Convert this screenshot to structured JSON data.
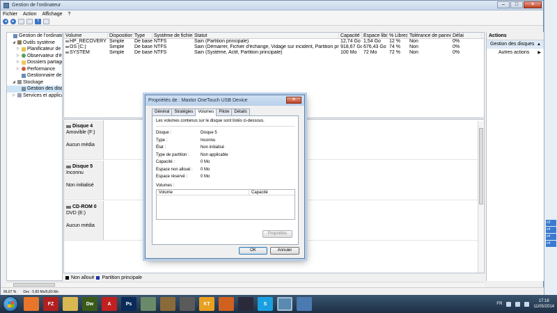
{
  "window": {
    "title": "Gestion de l'ordinateur",
    "controls": [
      "–",
      "□",
      "✕"
    ]
  },
  "menu": [
    "Fichier",
    "Action",
    "Affichage",
    "?"
  ],
  "tree": [
    {
      "label": "Gestion de l'ordinateur (l",
      "indent": 0,
      "arrow": "",
      "icon": "pc"
    },
    {
      "label": "Outils système",
      "indent": 1,
      "arrow": "◢",
      "icon": "tools"
    },
    {
      "label": "Planificateur de t",
      "indent": 2,
      "arrow": "▷",
      "icon": "yellow"
    },
    {
      "label": "Observateur d'évén",
      "indent": 2,
      "arrow": "▷",
      "icon": "eye"
    },
    {
      "label": "Dossiers partagés",
      "indent": 2,
      "arrow": "▷",
      "icon": "folder"
    },
    {
      "label": "Performance",
      "indent": 2,
      "arrow": "▷",
      "icon": "perf"
    },
    {
      "label": "Gestionnaire de pé",
      "indent": 2,
      "arrow": "",
      "icon": "dev"
    },
    {
      "label": "Stockage",
      "indent": 1,
      "arrow": "◢",
      "icon": "store"
    },
    {
      "label": "Gestion des disque",
      "indent": 2,
      "arrow": "",
      "icon": "disk",
      "selected": true
    },
    {
      "label": "Services et applicatio",
      "indent": 1,
      "arrow": "▷",
      "icon": "svc"
    }
  ],
  "volumes": {
    "headers": [
      "Volume",
      "Disposition",
      "Type",
      "Système de fichiers",
      "Statut",
      "Capacité",
      "Espace libre",
      "% Libres",
      "Tolérance de pannes",
      "Délai"
    ],
    "rows": [
      [
        "HP_RECOVERY (D:)",
        "Simple",
        "De base",
        "NTFS",
        "Sain (Partition principale)",
        "12,74 Go",
        "1,54 Go",
        "12 %",
        "Non",
        "0%"
      ],
      [
        "OS (C:)",
        "Simple",
        "De base",
        "NTFS",
        "Sain (Démarrer, Fichier d'échange, Vidage sur incident, Partition principale)",
        "918,67 Go",
        "676,43 Go",
        "74 %",
        "Non",
        "0%"
      ],
      [
        "SYSTEM",
        "Simple",
        "De base",
        "NTFS",
        "Sain (Système, Actif, Partition principale)",
        "100 Mo",
        "72 Mo",
        "72 %",
        "Non",
        "0%"
      ]
    ]
  },
  "disks": [
    {
      "name": "Disque 4",
      "line1": "Amovible (F:)",
      "state": "Aucun média"
    },
    {
      "name": "Disque 5",
      "line1": "Inconnu",
      "state": "Non initialisé"
    },
    {
      "name": "CD-ROM 0",
      "line1": "DVD (E:)",
      "state": "Aucun média"
    }
  ],
  "legend": [
    "Non alloué",
    "Partition principale"
  ],
  "actions": {
    "header": "Actions",
    "item": "Gestion des disques",
    "sub": "Autres actions"
  },
  "status": {
    "zoom": "66,67 %",
    "info": "Dec : 5,83 Mo/5,83 Mo"
  },
  "edge_cells": [
    "v3",
    "v4",
    "v4",
    "v4"
  ],
  "dialog": {
    "title": "Propriétés de : Maxtor OneTouch USB Device",
    "close": "✕",
    "tabs": [
      "Général",
      "Stratégies",
      "Volumes",
      "Pilote",
      "Détails"
    ],
    "active_tab": 2,
    "intro": "Les volumes contenus sur le disque sont listés ci-dessous.",
    "props": [
      {
        "k": "Disque :",
        "v": "Disque 5"
      },
      {
        "k": "Type :",
        "v": "Inconnu"
      },
      {
        "k": "État :",
        "v": "Non initialisé"
      },
      {
        "k": "Type de partition :",
        "v": "Non applicable"
      },
      {
        "k": "Capacité :",
        "v": "0 Mo"
      },
      {
        "k": "Espace non alloué :",
        "v": "0 Mo"
      },
      {
        "k": "Espace réservé :",
        "v": "0 Mo"
      }
    ],
    "volumes_label": "Volumes :",
    "vol_headers": [
      "Volume",
      "Capacité"
    ],
    "props_button": "Propriétés",
    "ok": "OK",
    "cancel": "Annuler"
  },
  "taskbar": {
    "apps": [
      {
        "label": "",
        "color": "#e8762a",
        "name": "firefox-icon"
      },
      {
        "label": "FZ",
        "color": "#b02020",
        "name": "filezilla-icon"
      },
      {
        "label": "",
        "color": "#d8b850",
        "name": "explorer-icon"
      },
      {
        "label": "Dw",
        "color": "#3a5a1a",
        "name": "dreamweaver-icon"
      },
      {
        "label": "A",
        "color": "#c02020",
        "name": "acrobat-icon"
      },
      {
        "label": "Ps",
        "color": "#0a2a5a",
        "name": "photoshop-icon"
      },
      {
        "label": "",
        "color": "#6a8a6a",
        "name": "mail-icon"
      },
      {
        "label": "",
        "color": "#8a6a3a",
        "name": "library-icon"
      },
      {
        "label": "",
        "color": "#5a5a5a",
        "name": "media-icon"
      },
      {
        "label": "KT",
        "color": "#e8a020",
        "name": "kt-icon"
      },
      {
        "label": "",
        "color": "#d06020",
        "name": "basketball-icon"
      },
      {
        "label": "",
        "color": "#2a2a3a",
        "name": "moon-icon"
      },
      {
        "label": "S",
        "color": "#1aa0e0",
        "name": "skype-icon"
      },
      {
        "label": "",
        "color": "#5a8ab0",
        "name": "computer-management-icon"
      },
      {
        "label": "",
        "color": "#4a7ab0",
        "name": "network-icon"
      }
    ],
    "lang": "FR",
    "time": "17:18",
    "date": "11/05/2014"
  }
}
